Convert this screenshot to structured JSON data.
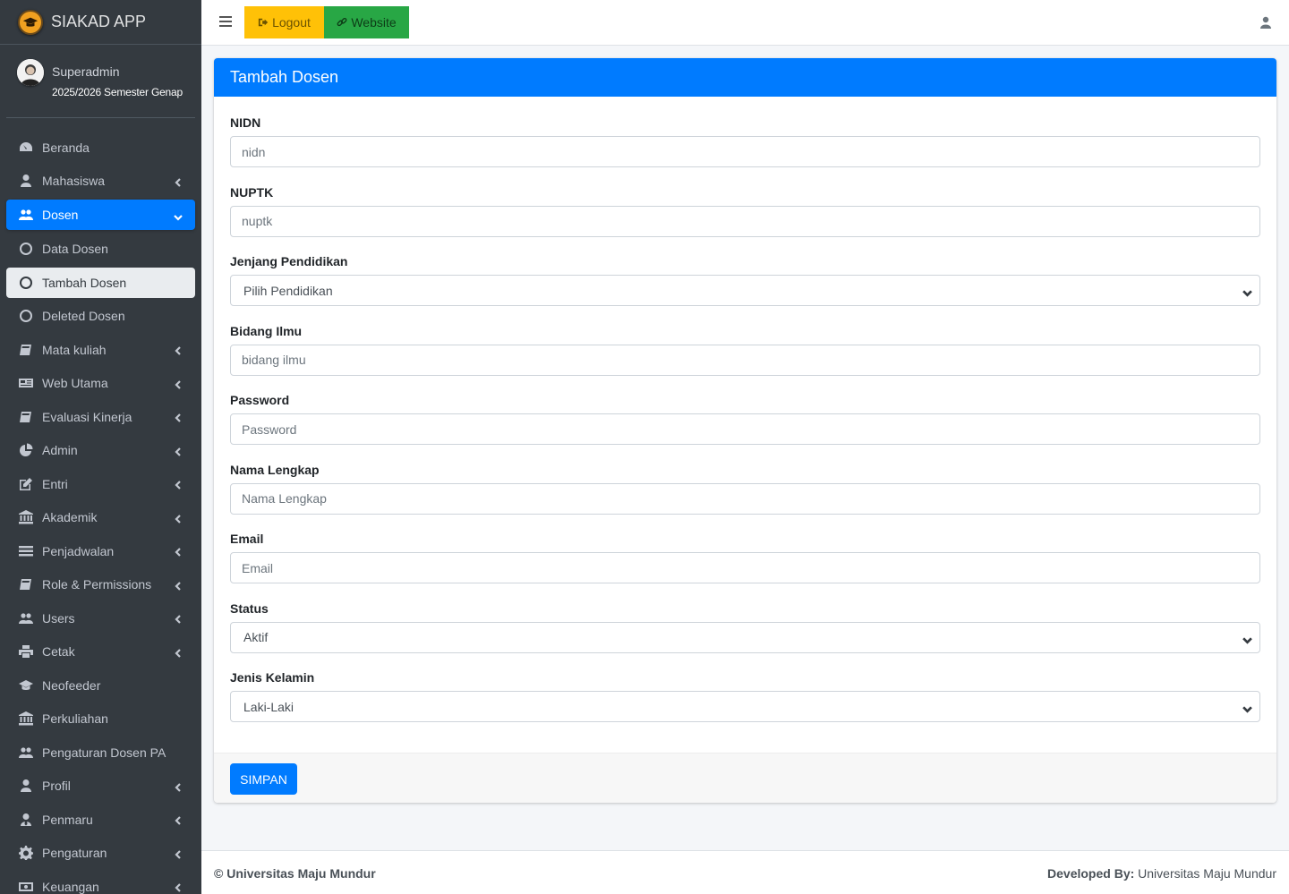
{
  "brand": {
    "name": "SIAKAD APP"
  },
  "user": {
    "name": "Superadmin",
    "semester": "2025/2026 Semester Genap"
  },
  "sidebar": {
    "items": [
      {
        "label": "Beranda",
        "icon": "tachometer-icon",
        "chevron": false
      },
      {
        "label": "Mahasiswa",
        "icon": "user-icon",
        "chevron": true
      },
      {
        "label": "Dosen",
        "icon": "users-icon",
        "chevron": true,
        "state": "active"
      },
      {
        "label": "Data Dosen",
        "icon": "circle-icon",
        "chevron": false
      },
      {
        "label": "Tambah Dosen",
        "icon": "circle-icon",
        "chevron": false,
        "state": "sub-active"
      },
      {
        "label": "Deleted Dosen",
        "icon": "circle-icon",
        "chevron": false
      },
      {
        "label": "Mata kuliah",
        "icon": "book-icon",
        "chevron": true
      },
      {
        "label": "Web Utama",
        "icon": "newspaper-icon",
        "chevron": true
      },
      {
        "label": "Evaluasi Kinerja",
        "icon": "book-icon",
        "chevron": true
      },
      {
        "label": "Admin",
        "icon": "chart-pie-icon",
        "chevron": true
      },
      {
        "label": "Entri",
        "icon": "edit-icon",
        "chevron": true
      },
      {
        "label": "Akademik",
        "icon": "university-icon",
        "chevron": true
      },
      {
        "label": "Penjadwalan",
        "icon": "list-icon",
        "chevron": true
      },
      {
        "label": "Role & Permissions",
        "icon": "book-icon",
        "chevron": true
      },
      {
        "label": "Users",
        "icon": "users-icon",
        "chevron": true
      },
      {
        "label": "Cetak",
        "icon": "print-icon",
        "chevron": true
      },
      {
        "label": "Neofeeder",
        "icon": "graduation-cap-icon",
        "chevron": false
      },
      {
        "label": "Perkuliahan",
        "icon": "university-icon",
        "chevron": false
      },
      {
        "label": "Pengaturan Dosen PA",
        "icon": "users-icon",
        "chevron": false
      },
      {
        "label": "Profil",
        "icon": "user-icon",
        "chevron": true
      },
      {
        "label": "Penmaru",
        "icon": "user-tie-icon",
        "chevron": true
      },
      {
        "label": "Pengaturan",
        "icon": "gear-icon",
        "chevron": true
      },
      {
        "label": "Keuangan",
        "icon": "money-icon",
        "chevron": true
      }
    ]
  },
  "topbar": {
    "logout_label": "Logout",
    "website_label": "Website"
  },
  "form": {
    "title": "Tambah Dosen",
    "fields": [
      {
        "label": "NIDN",
        "type": "input",
        "placeholder": "nidn"
      },
      {
        "label": "NUPTK",
        "type": "input",
        "placeholder": "nuptk"
      },
      {
        "label": "Jenjang Pendidikan",
        "type": "select",
        "value": "Pilih Pendidikan"
      },
      {
        "label": "Bidang Ilmu",
        "type": "input",
        "placeholder": "bidang ilmu"
      },
      {
        "label": "Password",
        "type": "input",
        "placeholder": "Password"
      },
      {
        "label": "Nama Lengkap",
        "type": "input",
        "placeholder": "Nama Lengkap"
      },
      {
        "label": "Email",
        "type": "input",
        "placeholder": "Email"
      },
      {
        "label": "Status",
        "type": "select",
        "value": "Aktif"
      },
      {
        "label": "Jenis Kelamin",
        "type": "select",
        "value": "Laki-Laki"
      }
    ],
    "submit_label": "SIMPAN"
  },
  "footer": {
    "copyright": "© Universitas Maju Mundur",
    "developed_by_label": "Developed By:",
    "developed_by_value": "Universitas Maju Mundur"
  },
  "colors": {
    "primary": "#007bff",
    "sidebar_bg": "#343a40",
    "logout_bg": "#ffc107",
    "website_bg": "#28a745"
  }
}
